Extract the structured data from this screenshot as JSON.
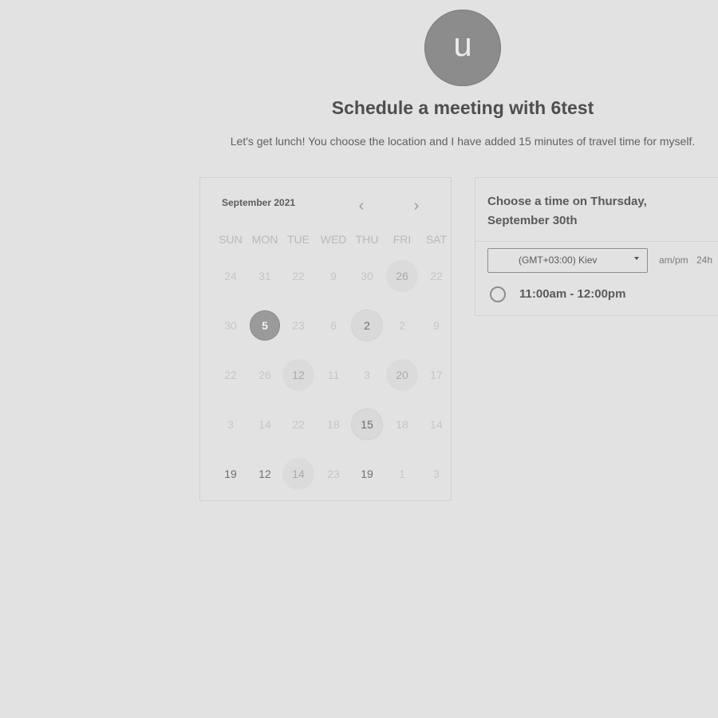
{
  "host": {
    "avatar_initial": "u",
    "title": "Schedule a meeting with 6test",
    "description": "Let's get lunch! You choose the location and I have added 15 minutes of travel time for myself."
  },
  "calendar": {
    "month_label": "September 2021",
    "prev_icon": "chevron-left-icon",
    "next_icon": "chevron-right-icon",
    "prev_glyph": "‹",
    "next_glyph": "›",
    "weekdays": [
      "SUN",
      "MON",
      "TUE",
      "WED",
      "THU",
      "FRI",
      "SAT"
    ],
    "weeks": [
      [
        {
          "n": "24",
          "s": "disabled"
        },
        {
          "n": "31",
          "s": "disabled"
        },
        {
          "n": "22",
          "s": "disabled"
        },
        {
          "n": "9",
          "s": "disabled"
        },
        {
          "n": "30",
          "s": "disabled"
        },
        {
          "n": "26",
          "s": "shaded"
        },
        {
          "n": "22",
          "s": "disabled"
        }
      ],
      [
        {
          "n": "30",
          "s": "disabled"
        },
        {
          "n": "5",
          "s": "selected"
        },
        {
          "n": "23",
          "s": "disabled"
        },
        {
          "n": "6",
          "s": "disabled"
        },
        {
          "n": "2",
          "s": "available"
        },
        {
          "n": "2",
          "s": "disabled"
        },
        {
          "n": "9",
          "s": "disabled"
        }
      ],
      [
        {
          "n": "22",
          "s": "disabled"
        },
        {
          "n": "26",
          "s": "disabled"
        },
        {
          "n": "12",
          "s": "shaded"
        },
        {
          "n": "11",
          "s": "disabled"
        },
        {
          "n": "3",
          "s": "disabled"
        },
        {
          "n": "20",
          "s": "shaded"
        },
        {
          "n": "17",
          "s": "disabled"
        }
      ],
      [
        {
          "n": "3",
          "s": "disabled"
        },
        {
          "n": "14",
          "s": "disabled"
        },
        {
          "n": "22",
          "s": "disabled"
        },
        {
          "n": "18",
          "s": "disabled"
        },
        {
          "n": "15",
          "s": "available"
        },
        {
          "n": "18",
          "s": "disabled"
        },
        {
          "n": "14",
          "s": "disabled"
        }
      ],
      [
        {
          "n": "19",
          "s": "dark"
        },
        {
          "n": "12",
          "s": "dark"
        },
        {
          "n": "14",
          "s": "shaded"
        },
        {
          "n": "23",
          "s": "disabled"
        },
        {
          "n": "19",
          "s": "dark"
        },
        {
          "n": "1",
          "s": "disabled"
        },
        {
          "n": "3",
          "s": "disabled"
        }
      ]
    ]
  },
  "time_panel": {
    "heading": "Choose a time on Thursday, September 30th",
    "timezone_value": "(GMT+03:00) Kiev",
    "timezone_icon": "caret-down-icon",
    "format_ampm": "am/pm",
    "format_24h": "24h",
    "slots": [
      {
        "label": "11:00am - 12:00pm"
      }
    ]
  }
}
